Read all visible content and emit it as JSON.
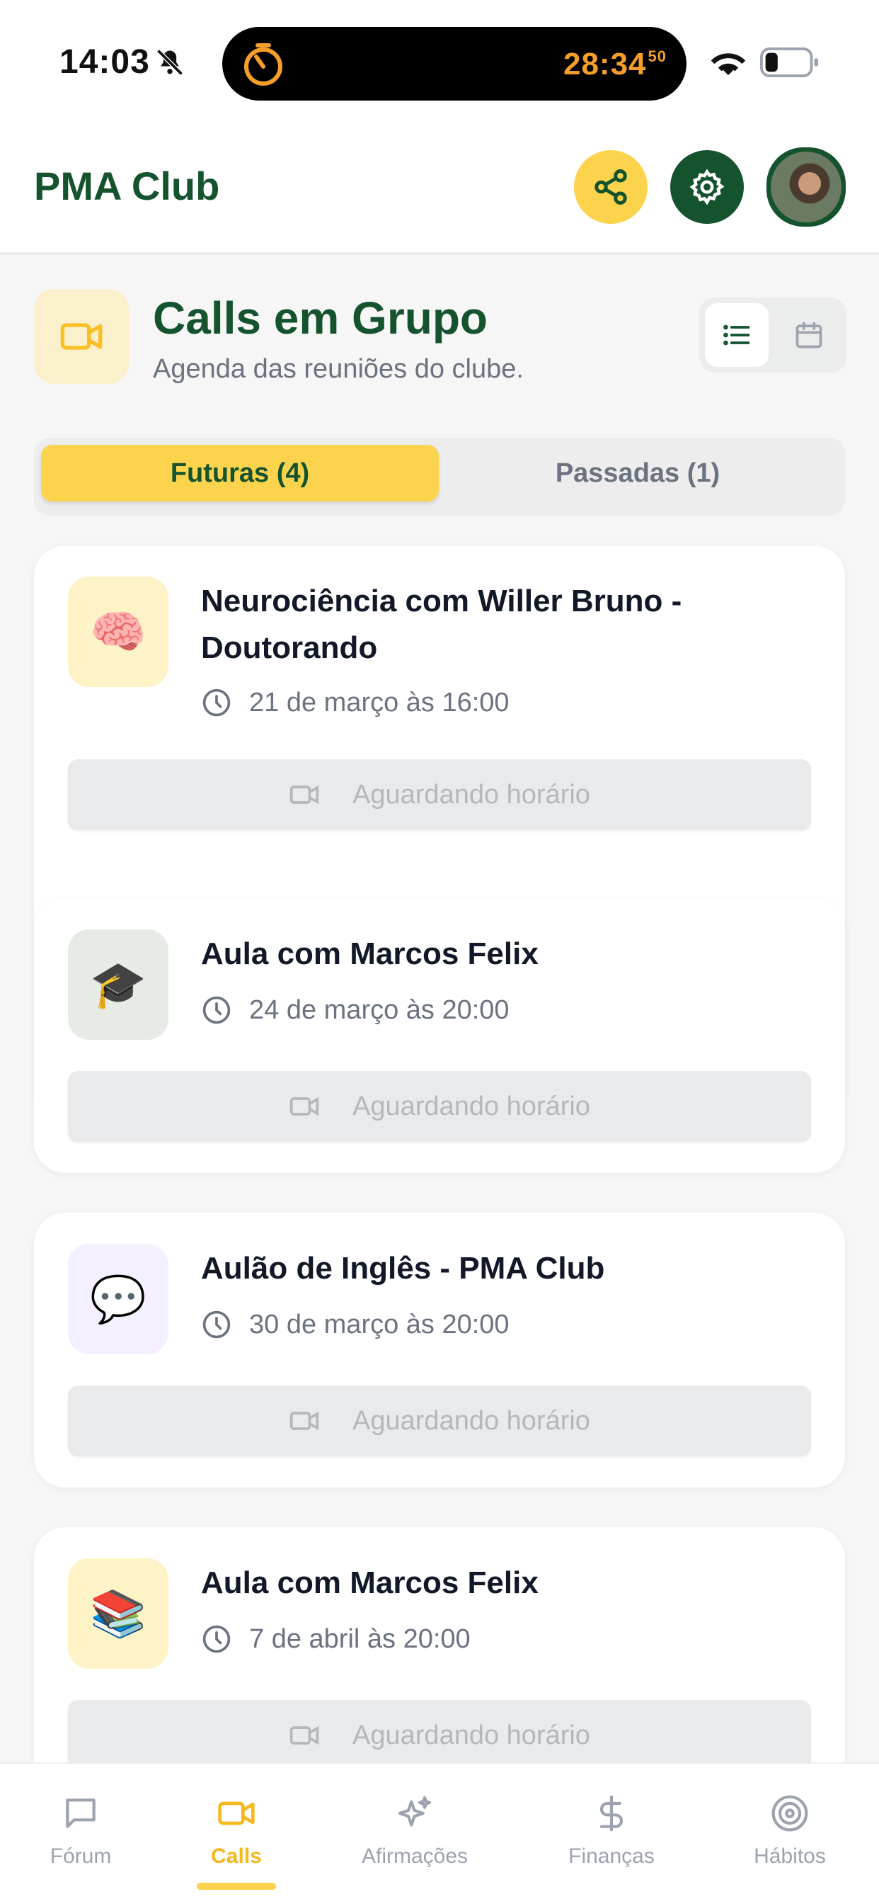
{
  "status_bar": {
    "time": "14:03",
    "timer": "28:34",
    "timer_fraction": "50"
  },
  "header": {
    "brand": "PMA Club"
  },
  "page": {
    "title": "Calls em Grupo",
    "subtitle": "Agenda das reuniões do clube."
  },
  "tabs": {
    "future": "Futuras (4)",
    "past": "Passadas (1)"
  },
  "calls": [
    {
      "emoji": "🧠",
      "title": "Neurociência com Willer Bruno - Doutorando",
      "time": "21 de março às 16:00",
      "button": "Aguardando horário",
      "icon_bg": "#fef3c7"
    },
    {
      "emoji": "🎓",
      "title": "Aula com Marcos Felix",
      "time": "24 de março às 20:00",
      "button": "Aguardando horário",
      "icon_bg": "#e7ebe6"
    },
    {
      "emoji": "💬",
      "title": "Aulão de Inglês - PMA Club",
      "time": "30 de março às 20:00",
      "button": "Aguardando horário",
      "icon_bg": "#f5f0ff"
    },
    {
      "emoji": "📚",
      "title": "Aula com Marcos Felix",
      "time": "7 de abril às 20:00",
      "button": "Aguardando horário",
      "icon_bg": "#fef3c7"
    }
  ],
  "nav": {
    "forum": "Fórum",
    "calls": "Calls",
    "affirmations": "Afirmações",
    "finance": "Finanças",
    "habits": "Hábitos"
  },
  "colors": {
    "brand_green": "#14532d",
    "accent_yellow": "#fcd34d",
    "timer_orange": "#f59e2b"
  }
}
